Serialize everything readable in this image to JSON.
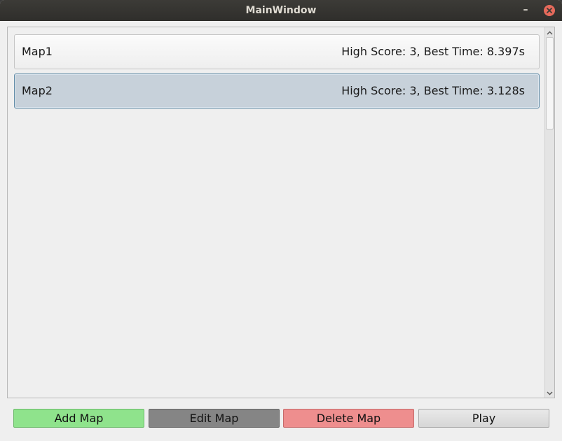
{
  "window": {
    "title": "MainWindow",
    "minimize_label": "–"
  },
  "maps": [
    {
      "name": "Map1",
      "stats": "High Score: 3, Best Time: 8.397s",
      "selected": false
    },
    {
      "name": "Map2",
      "stats": "High Score: 3, Best Time: 3.128s",
      "selected": true
    }
  ],
  "buttons": {
    "add": "Add Map",
    "edit": "Edit Map",
    "delete": "Delete Map",
    "play": "Play"
  },
  "colors": {
    "add_button": "#8fe38c",
    "edit_button": "#858585",
    "delete_button": "#ee8e8e",
    "play_button": "#dedede",
    "selected_item": "#c7d1da",
    "close_button": "#e66a5b"
  },
  "icons": {
    "close": "close-icon",
    "minimize": "minimize-icon",
    "scroll_up": "chevron-up-icon",
    "scroll_down": "chevron-down-icon"
  }
}
